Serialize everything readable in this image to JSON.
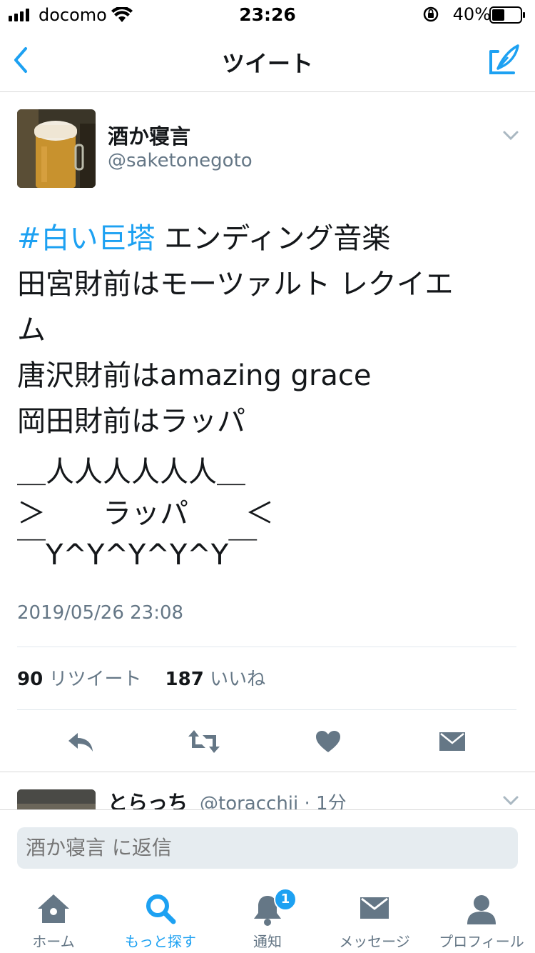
{
  "status_bar": {
    "carrier": "docomo",
    "time": "23:26",
    "battery": "40%"
  },
  "nav": {
    "title": "ツイート",
    "back_icon": "chevron-left-icon",
    "compose_icon": "compose-quill-icon"
  },
  "tweet": {
    "display_name": "酒か寝言",
    "handle": "@saketonegoto",
    "hashtag": "#白い巨塔",
    "body_lines": [
      " エンディング音楽",
      "田宮財前はモーツァルト レクイエ",
      "ム",
      "唐沢財前はamazing grace",
      "岡田財前はラッパ"
    ],
    "ascii_art": [
      "＿人人人人人人＿",
      "＞　　ラッパ　　＜",
      "￣Y^Y^Y^Y^Y￣"
    ],
    "timestamp": "2019/05/26 23:08",
    "retweet_count": "90",
    "retweet_label": "リツイート",
    "like_count": "187",
    "like_label": "いいね"
  },
  "reply_preview": {
    "display_name": "とらっち",
    "handle_time": "@toracchii · 1分"
  },
  "composer": {
    "placeholder": "酒か寝言 に返信"
  },
  "tabs": [
    {
      "label": "ホーム",
      "icon": "home-icon"
    },
    {
      "label": "もっと探す",
      "icon": "search-icon",
      "active": true
    },
    {
      "label": "通知",
      "icon": "bell-icon",
      "badge": "1"
    },
    {
      "label": "メッセージ",
      "icon": "envelope-icon"
    },
    {
      "label": "プロフィール",
      "icon": "person-icon"
    }
  ],
  "colors": {
    "accent": "#1da1f2",
    "secondary_text": "#657786",
    "action_icon": "#657786"
  }
}
